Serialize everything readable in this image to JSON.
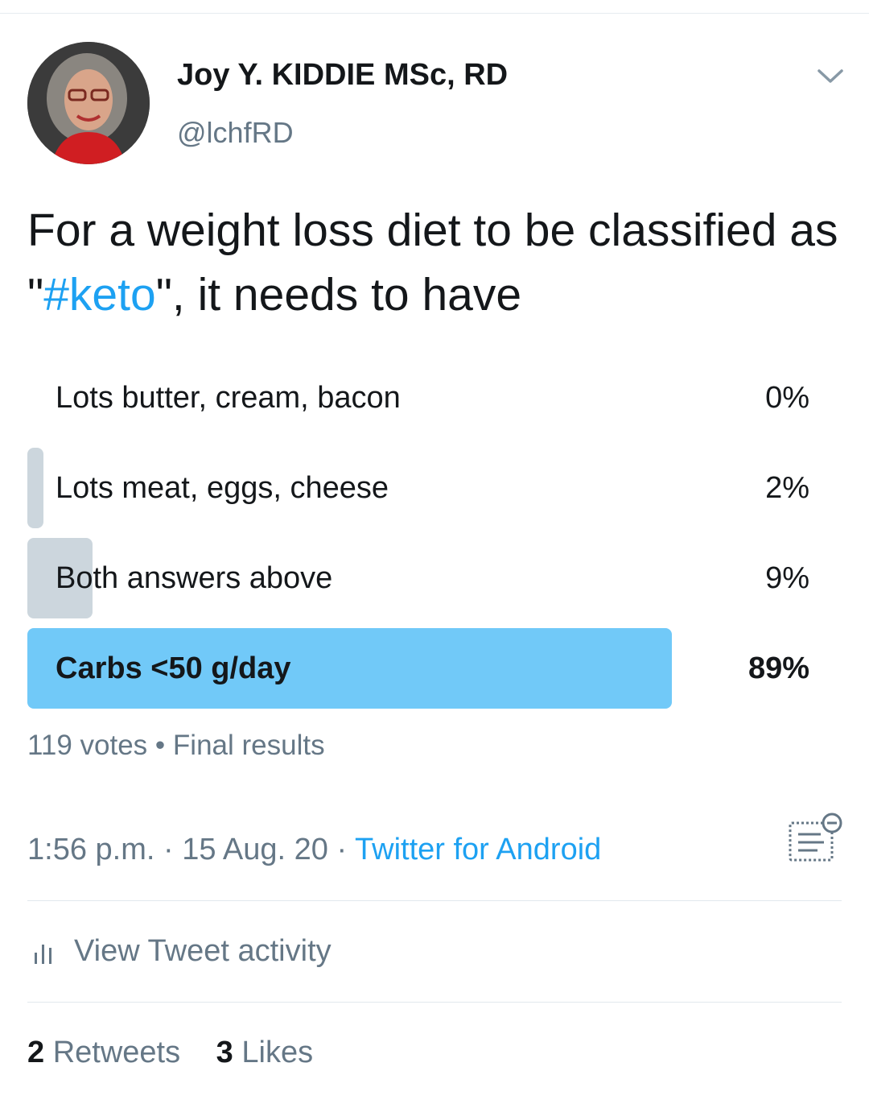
{
  "author": {
    "name": "Joy Y. KIDDIE MSc, RD",
    "handle": "@lchfRD"
  },
  "tweet": {
    "text_before": "For a weight loss diet to be classified as \"",
    "hashtag": "#keto",
    "text_after": "\", it needs to have"
  },
  "poll": {
    "options": [
      {
        "label": "Lots butter, cream, bacon",
        "percent": "0%",
        "value": 0
      },
      {
        "label": "Lots meat, eggs, cheese",
        "percent": "2%",
        "value": 2
      },
      {
        "label": "Both answers above",
        "percent": "9%",
        "value": 9
      },
      {
        "label": "Carbs <50 g/day",
        "percent": "89%",
        "value": 89,
        "winner": true
      }
    ],
    "votes": "119 votes",
    "separator": "•",
    "status": "Final results"
  },
  "meta": {
    "time": "1:56 p.m.",
    "date": "15 Aug. 20",
    "separator": "·",
    "source": "Twitter for Android"
  },
  "activity": {
    "label": "View Tweet activity"
  },
  "stats": {
    "retweets_count": "2",
    "retweets_label": "Retweets",
    "likes_count": "3",
    "likes_label": "Likes"
  },
  "colors": {
    "accent": "#1da1f2",
    "poll_winner": "#71c9f8",
    "poll_bar": "#ccd6dd",
    "secondary_text": "#657786"
  },
  "icons": {
    "chevron": "chevron-down-icon",
    "notes": "notes-icon",
    "activity": "bar-chart-icon"
  }
}
